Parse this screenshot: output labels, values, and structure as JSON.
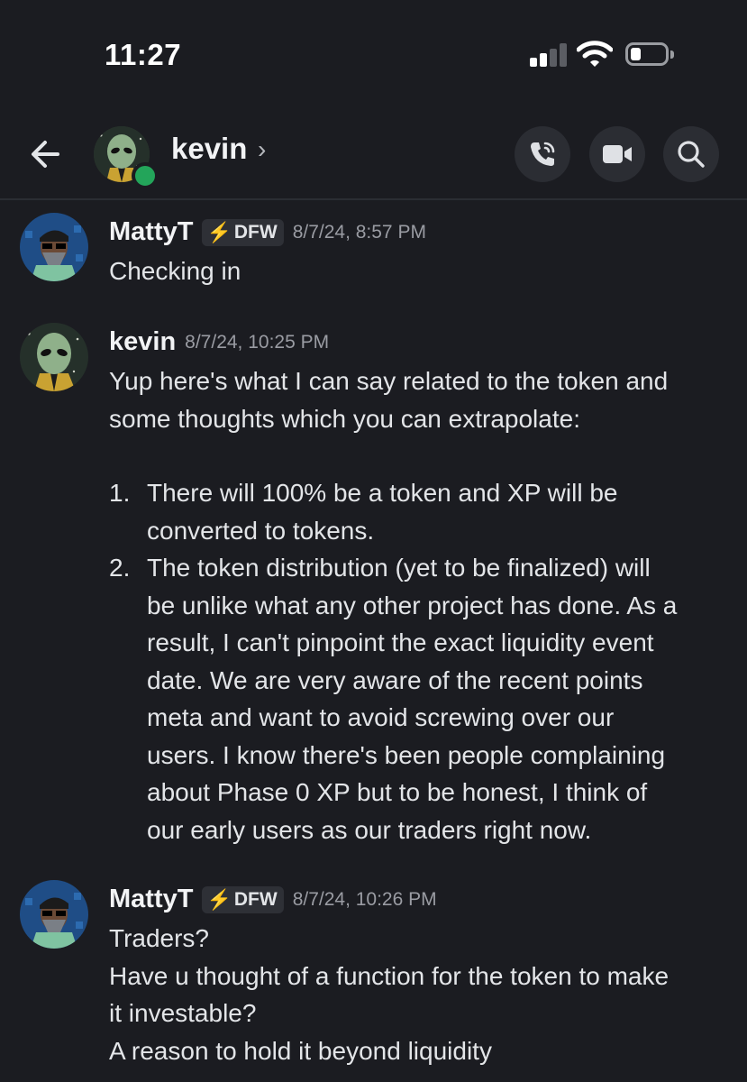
{
  "status_bar": {
    "time": "11:27"
  },
  "header": {
    "name": "kevin",
    "chevron": "›",
    "icons": [
      "back-arrow-icon",
      "call-icon",
      "video-icon",
      "search-icon"
    ]
  },
  "messages": [
    {
      "author": "MattyT",
      "tag": "DFW",
      "tag_icon": "lightning-icon",
      "timestamp": "8/7/24, 8:57 PM",
      "lines": [
        "Checking in"
      ]
    },
    {
      "author": "kevin",
      "timestamp": "8/7/24, 10:25 PM",
      "intro": [
        "Yup here's what I can say related to the token and",
        "some thoughts which you can extrapolate:"
      ],
      "list": [
        {
          "number": "1.",
          "lines": [
            "There will 100% be a token and XP will be",
            "converted to tokens."
          ]
        },
        {
          "number": "2.",
          "lines": [
            "The token distribution (yet to be finalized) will",
            "be unlike what any other project has done. As a",
            "result, I can't pinpoint the exact liquidity event",
            "date. We are very aware of the recent points",
            "meta and want to avoid screwing over our",
            "users. I know there's been people complaining",
            "about Phase 0 XP but to be honest, I think of",
            "our early users as our traders right now."
          ]
        }
      ]
    },
    {
      "author": "MattyT",
      "tag": "DFW",
      "tag_icon": "lightning-icon",
      "timestamp": "8/7/24, 10:26 PM",
      "lines": [
        "Traders?",
        "Have u thought of a function for the token to make",
        "it investable?",
        "A reason to hold it beyond liquidity"
      ]
    }
  ]
}
